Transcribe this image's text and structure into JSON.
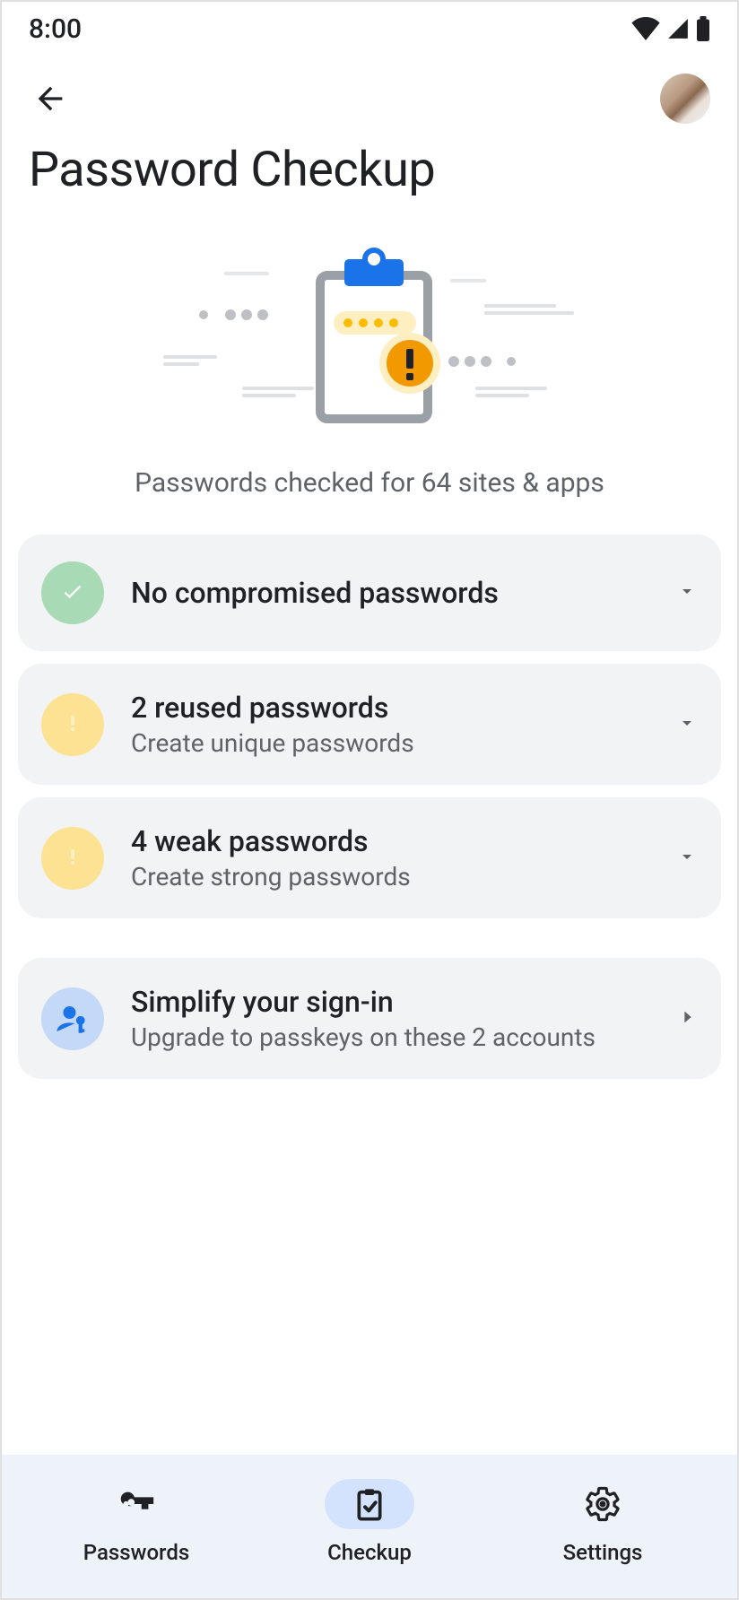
{
  "status_bar": {
    "time": "8:00"
  },
  "header": {
    "title": "Password Checkup"
  },
  "summary": "Passwords checked for 64 sites & apps",
  "cards": [
    {
      "icon": "check-circle",
      "title": "No compromised passwords",
      "subtitle": "",
      "arrow": "down"
    },
    {
      "icon": "warning-circle",
      "title": "2 reused passwords",
      "subtitle": "Create unique passwords",
      "arrow": "down"
    },
    {
      "icon": "warning-circle",
      "title": "4 weak passwords",
      "subtitle": "Create strong passwords",
      "arrow": "down"
    }
  ],
  "passkey_card": {
    "icon": "passkey-person",
    "title": "Simplify your sign-in",
    "subtitle": "Upgrade to passkeys on these 2 accounts",
    "arrow": "right"
  },
  "nav": {
    "items": [
      {
        "icon": "key",
        "label": "Passwords",
        "active": false
      },
      {
        "icon": "clipboard-check",
        "label": "Checkup",
        "active": true
      },
      {
        "icon": "gear",
        "label": "Settings",
        "active": false
      }
    ]
  }
}
